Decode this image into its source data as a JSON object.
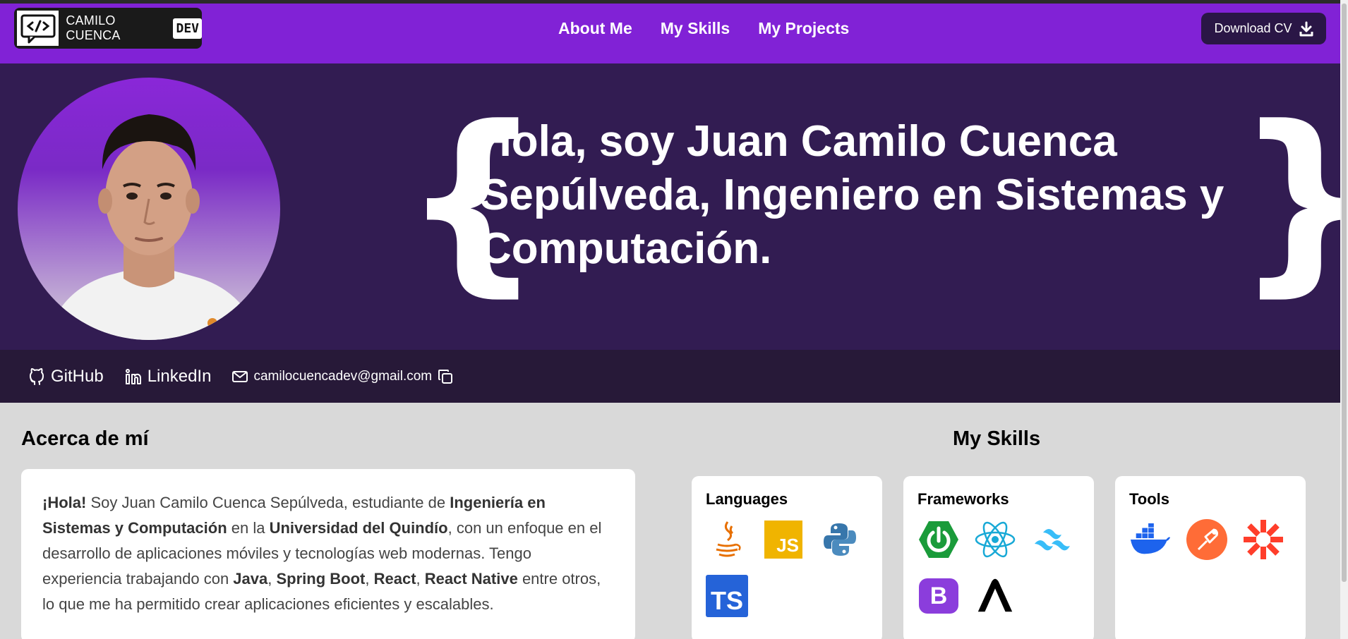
{
  "navbar": {
    "logo_text": "CAMILO CUENCA",
    "logo_badge": "DEV",
    "links": [
      "About Me",
      "My Skills",
      "My Projects"
    ],
    "cv_button": "Download CV"
  },
  "hero": {
    "title": "Hola, soy Juan Camilo Cuenca Sepúlveda, Ingeniero en Sistemas y Computación.",
    "brace_left": "{",
    "brace_right": "}"
  },
  "contacts": {
    "github": "GitHub",
    "linkedin": "LinkedIn",
    "email": "camilocuencadev@gmail.com"
  },
  "about": {
    "title": "Acerca de mí",
    "p1": "¡Hola!",
    "p2": " Soy Juan Camilo Cuenca Sepúlveda, estudiante de ",
    "p3": "Ingeniería en Sistemas y Computación",
    "p4": " en la ",
    "p5": "Universidad del Quindío",
    "p6": ", con un enfoque en el desarrollo de aplicaciones móviles y tecnologías web modernas. Tengo experiencia trabajando con ",
    "p7": "Java",
    "p8": ", ",
    "p9": "Spring Boot",
    "p10": ", ",
    "p11": "React",
    "p12": ", ",
    "p13": "React Native",
    "p14": " entre otros, lo que me ha permitido crear aplicaciones eficientes y escalables."
  },
  "skills": {
    "title": "My Skills",
    "cards": [
      {
        "title": "Languages",
        "icons": [
          "java-icon",
          "javascript-icon",
          "python-icon",
          "typescript-icon"
        ]
      },
      {
        "title": "Frameworks",
        "icons": [
          "spring-boot-icon",
          "react-icon",
          "tailwind-icon",
          "bootstrap-icon",
          "astro-icon"
        ]
      },
      {
        "title": "Tools",
        "icons": [
          "docker-icon",
          "postman-icon",
          "zapier-icon"
        ]
      }
    ],
    "js_text": "JS",
    "ts_text": "TS",
    "bs_text": "B"
  }
}
